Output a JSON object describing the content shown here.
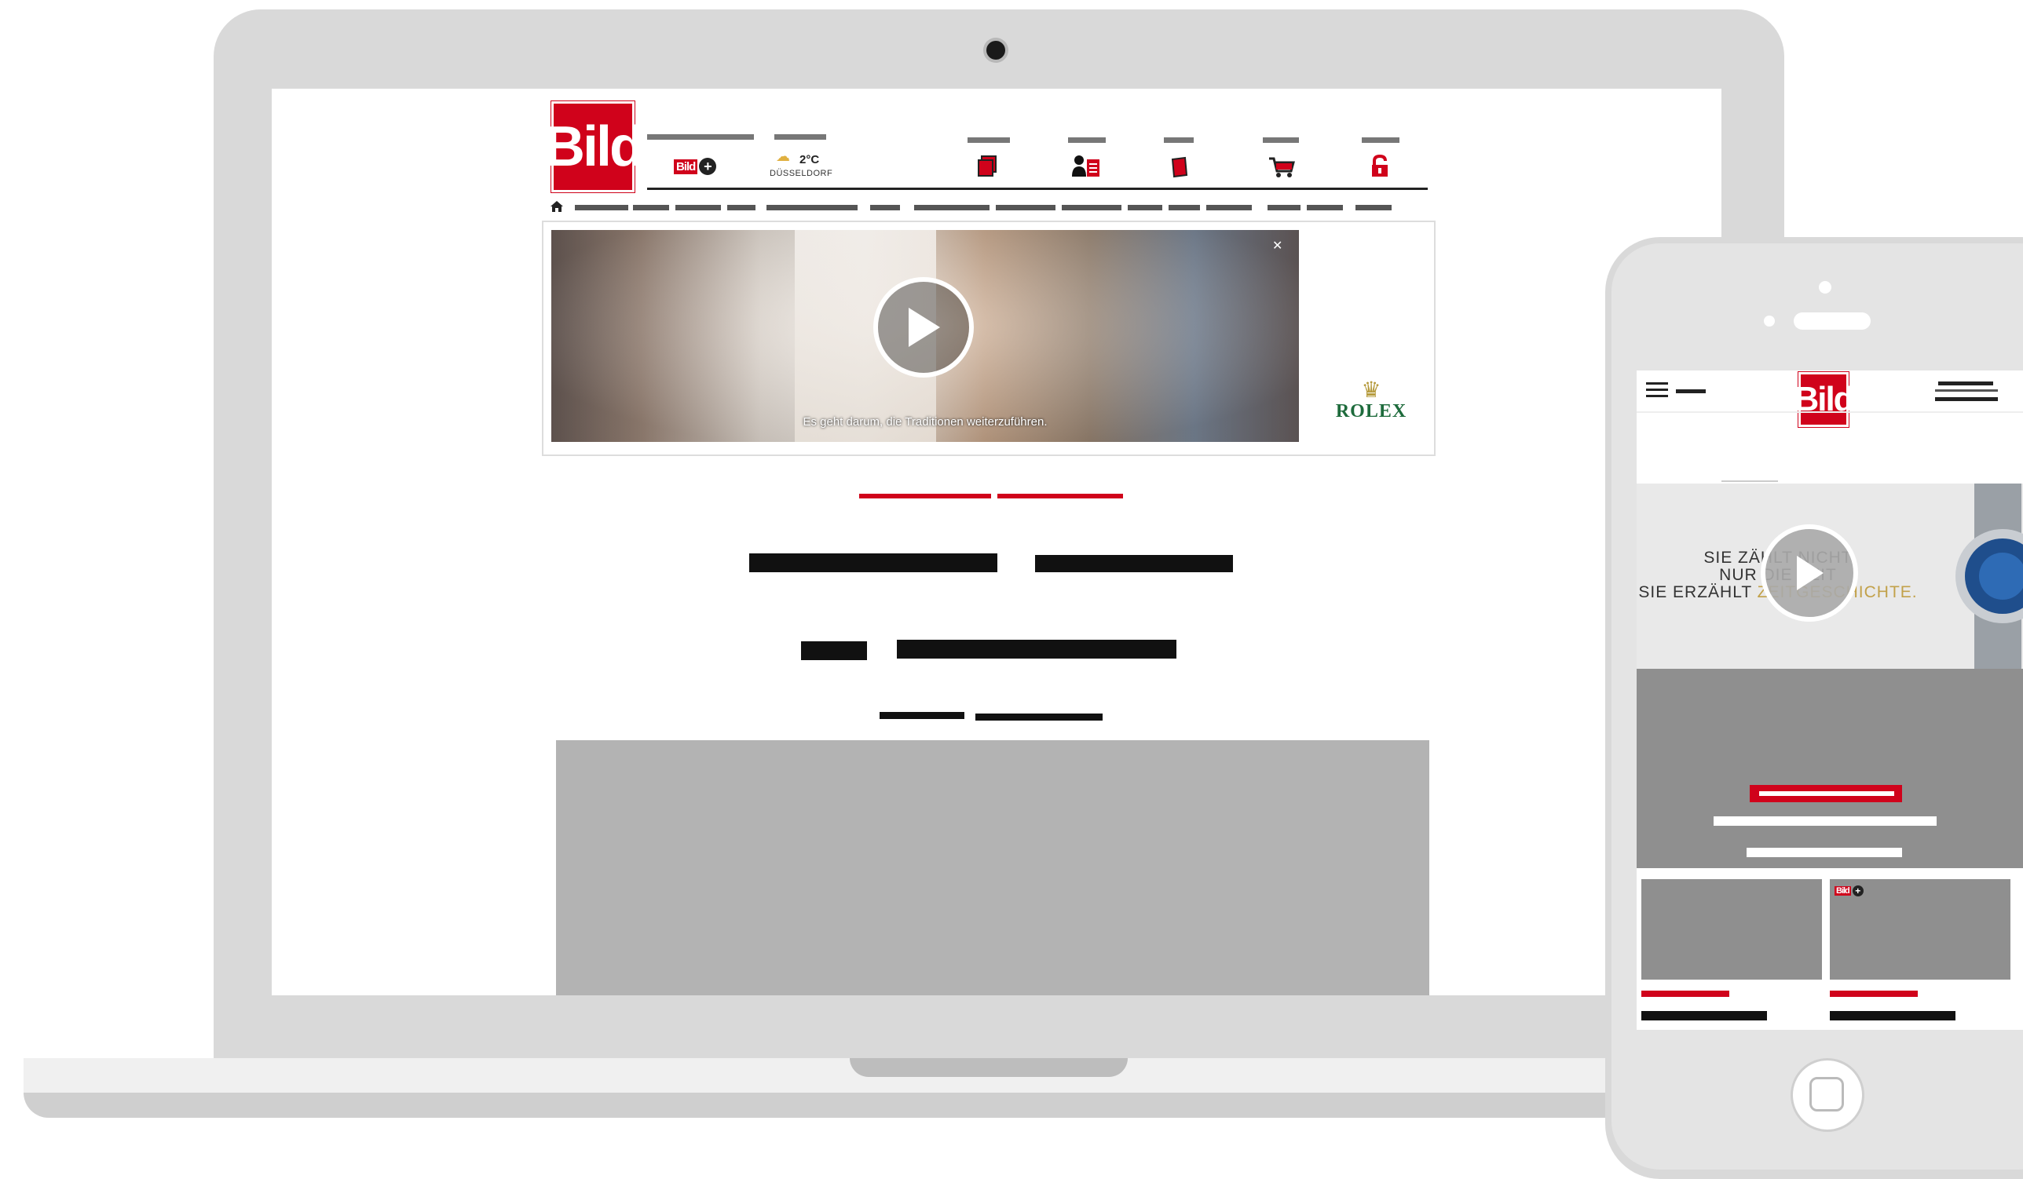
{
  "laptop": {
    "site": {
      "logo_text": "Bild",
      "bildplus_text": "Bild",
      "weather": {
        "temp": "2°C",
        "city": "DÜSSELDORF"
      },
      "icons": [
        "newspaper-icon",
        "person-card-icon",
        "book-icon",
        "cart-icon",
        "lock-icon"
      ],
      "video": {
        "caption": "Es geht darum, die Traditionen weiterzuführen.",
        "brand": "ROLEX"
      }
    }
  },
  "phone": {
    "site": {
      "logo_text": "Bild",
      "video_text": {
        "line1": "SIE ZÄHLT NICHT",
        "line2": "NUR DIE ZEIT",
        "line3a": "SIE ERZÄHLT ",
        "line3b": "ZEITGESCHICHTE."
      },
      "bildplus_text": "Bild"
    }
  },
  "colors": {
    "brand_red": "#d0021b",
    "device_gray": "#d9d9d9",
    "placeholder_gray": "#b3b3b3"
  }
}
